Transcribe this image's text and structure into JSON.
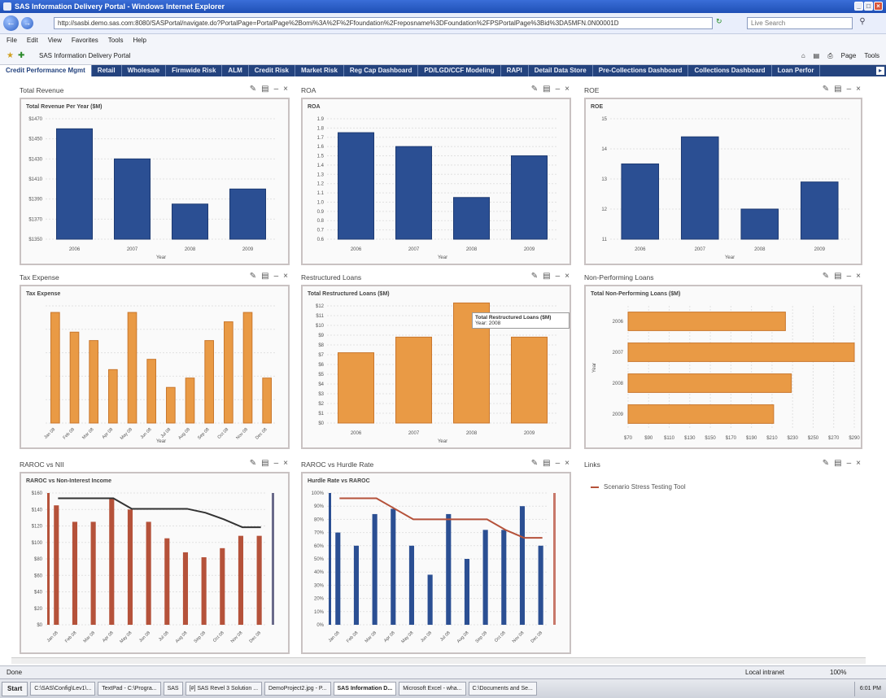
{
  "window": {
    "title": "SAS Information Delivery Portal - Windows Internet Explorer",
    "controls": [
      "_",
      "□",
      "×"
    ]
  },
  "browser": {
    "address": "http://sasbi.demo.sas.com:8080/SASPortal/navigate.do?PortalPage=PortalPage%2Bomi%3A%2F%2Ffoundation%2Freposname%3DFoundation%2FPSPortalPage%3Bid%3DA5MFN.0N00001D",
    "search_placeholder": "Live Search",
    "menu": [
      "File",
      "Edit",
      "View",
      "Favorites",
      "Tools",
      "Help"
    ],
    "fav_tab": "SAS Information Delivery Portal",
    "tools": [
      "Page",
      "Tools"
    ]
  },
  "tabs": [
    {
      "label": "Credit Performance Mgmt",
      "active": true
    },
    {
      "label": "Retail"
    },
    {
      "label": "Wholesale"
    },
    {
      "label": "Firmwide Risk"
    },
    {
      "label": "ALM"
    },
    {
      "label": "Credit Risk"
    },
    {
      "label": "Market Risk"
    },
    {
      "label": "Reg Cap Dashboard"
    },
    {
      "label": "PD/LGD/CCF Modeling"
    },
    {
      "label": "RAPI"
    },
    {
      "label": "Detail Data Store"
    },
    {
      "label": "Pre-Collections Dashboard"
    },
    {
      "label": "Collections Dashboard"
    },
    {
      "label": "Loan Perfor"
    }
  ],
  "portlets": {
    "total_revenue": {
      "title": "Total Revenue"
    },
    "roa": {
      "title": "ROA"
    },
    "roe": {
      "title": "ROE"
    },
    "tax_expense": {
      "title": "Tax Expense"
    },
    "restructured_loans": {
      "title": "Restructured Loans"
    },
    "non_performing_loans": {
      "title": "Non-Performing Loans"
    },
    "raroc_nii": {
      "title": "RAROC vs NII"
    },
    "raroc_hurdle": {
      "title": "RAROC vs Hurdle Rate"
    },
    "links": {
      "title": "Links",
      "subtitle": "",
      "items": [
        "Scenario Stress Testing Tool"
      ]
    }
  },
  "tooltip": {
    "line1": "Total Restructured Loans ($M)",
    "line2": "Year: 2008"
  },
  "chart_data": [
    {
      "type": "bar",
      "title": "Total Revenue Per Year ($M)",
      "xlabel": "Year",
      "ylabel": "",
      "categories": [
        "2006",
        "2007",
        "2008",
        "2009"
      ],
      "values": [
        1460,
        1430,
        1385,
        1400
      ],
      "ylim": [
        1350,
        1470
      ],
      "yticks": [
        "$1350",
        "$1370",
        "$1390",
        "$1410",
        "$1430",
        "$1450",
        "$1470"
      ],
      "color": "#2b4f93"
    },
    {
      "type": "bar",
      "title": "ROA",
      "xlabel": "Year",
      "ylabel": "",
      "categories": [
        "2006",
        "2007",
        "2008",
        "2009"
      ],
      "values": [
        1.75,
        1.6,
        1.05,
        1.5
      ],
      "ylim": [
        0.6,
        1.9
      ],
      "yticks": [
        "0.6",
        "0.7",
        "0.8",
        "0.9",
        "1.0",
        "1.1",
        "1.2",
        "1.3",
        "1.4",
        "1.5",
        "1.6",
        "1.7",
        "1.8",
        "1.9"
      ],
      "color": "#2b4f93"
    },
    {
      "type": "bar",
      "title": "ROE",
      "xlabel": "Year",
      "ylabel": "",
      "categories": [
        "2006",
        "2007",
        "2008",
        "2009"
      ],
      "values": [
        13.5,
        14.4,
        12.0,
        12.9
      ],
      "ylim": [
        11,
        15
      ],
      "yticks": [
        "11",
        "12",
        "13",
        "14",
        "15"
      ],
      "color": "#2b4f93"
    },
    {
      "type": "bar",
      "title": "Tax Expense",
      "xlabel": "Year",
      "ylabel": "",
      "categories": [
        "Jan 08",
        "Feb 08",
        "Mar 08",
        "Apr 08",
        "May 08",
        "Jun 08",
        "Jul 08",
        "Aug 08",
        "Sep 08",
        "Oct 08",
        "Nov 08",
        "Dec 08"
      ],
      "values": [
        118,
        97,
        88,
        57,
        118,
        68,
        38,
        48,
        88,
        108,
        118,
        48
      ],
      "ylim": [
        0,
        125
      ],
      "yticks": [
        "",
        "",
        "",
        "",
        "",
        ""
      ],
      "color": "#e99a45"
    },
    {
      "type": "bar",
      "title": "Total Restructured Loans ($M)",
      "xlabel": "Year",
      "ylabel": "",
      "categories": [
        "2006",
        "2007",
        "2008",
        "2009"
      ],
      "values": [
        7.2,
        8.8,
        12.3,
        8.8
      ],
      "ylim": [
        0,
        12
      ],
      "yticks": [
        "$0",
        "$1",
        "$2",
        "$3",
        "$4",
        "$5",
        "$6",
        "$7",
        "$8",
        "$9",
        "$10",
        "$11",
        "$12"
      ],
      "color": "#e99a45"
    },
    {
      "type": "hbar",
      "title": "Total Non-Performing Loans ($M)",
      "xlabel": "",
      "ylabel": "Year",
      "categories": [
        "2006",
        "2007",
        "2008",
        "2009"
      ],
      "values": [
        230,
        300,
        236,
        218
      ],
      "xlim": [
        70,
        300
      ],
      "xticks": [
        "$70",
        "$90",
        "$110",
        "$130",
        "$150",
        "$170",
        "$190",
        "$210",
        "$230",
        "$250",
        "$270",
        "$290"
      ],
      "color": "#e99a45"
    },
    {
      "type": "bar+line",
      "title": "RAROC vs Non-Interest Income",
      "xlabel": "",
      "ylabel": "",
      "categories": [
        "Jan 08",
        "Feb 08",
        "Mar 08",
        "Apr 08",
        "May 08",
        "Jun 08",
        "Jul 08",
        "Aug 08",
        "Sep 08",
        "Oct 08",
        "Nov 08",
        "Dec 08"
      ],
      "series": [
        {
          "name": "Non-Interest Income",
          "type": "bar",
          "values": [
            145,
            125,
            125,
            153,
            140,
            125,
            105,
            88,
            82,
            93,
            108,
            108
          ],
          "color": "#b5523a"
        },
        {
          "name": "RAROC",
          "type": "line",
          "values": [
            0.96,
            0.96,
            0.96,
            0.96,
            0.88,
            0.88,
            0.88,
            0.88,
            0.85,
            0.8,
            0.74,
            0.74
          ],
          "color": "#333333"
        }
      ],
      "ylim": [
        0,
        160
      ],
      "yticks": [
        "$0",
        "$20",
        "$40",
        "$60",
        "$80",
        "$100",
        "$120",
        "$140",
        "$160"
      ]
    },
    {
      "type": "bar+line",
      "title": "Hurdle Rate vs RAROC",
      "xlabel": "",
      "ylabel": "",
      "categories": [
        "Jan 08",
        "Feb 08",
        "Mar 08",
        "Apr 08",
        "May 08",
        "Jun 08",
        "Jul 08",
        "Aug 08",
        "Sep 08",
        "Oct 08",
        "Nov 08",
        "Dec 08"
      ],
      "series": [
        {
          "name": "RAROC",
          "type": "bar",
          "values": [
            0.7,
            0.6,
            0.84,
            0.88,
            0.6,
            0.38,
            0.84,
            0.5,
            0.72,
            0.72,
            0.9,
            0.6
          ],
          "color": "#2b4f93"
        },
        {
          "name": "Hurdle Rate",
          "type": "line",
          "values": [
            0.96,
            0.96,
            0.96,
            0.88,
            0.8,
            0.8,
            0.8,
            0.8,
            0.8,
            0.72,
            0.66,
            0.66
          ],
          "color": "#b5523a"
        }
      ],
      "ylim": [
        0,
        1
      ],
      "yticks": [
        "0%",
        "10%",
        "20%",
        "30%",
        "40%",
        "50%",
        "60%",
        "70%",
        "80%",
        "90%",
        "100%"
      ]
    }
  ],
  "status": {
    "text": "Done",
    "zone": "Local intranet",
    "zoom": "100%"
  },
  "taskbar": {
    "start": "Start",
    "items": [
      "C:\\SAS\\Config\\Lev1\\...",
      "TextPad - C:\\Progra...",
      "SAS",
      "[#] SAS Revel 3 Solution ...",
      "DemoProject2.jpg - P...",
      "SAS Information D...",
      "Microsoft Excel - wha...",
      "C:\\Documents and Se..."
    ],
    "active_index": 5,
    "clock": "6:01 PM"
  }
}
